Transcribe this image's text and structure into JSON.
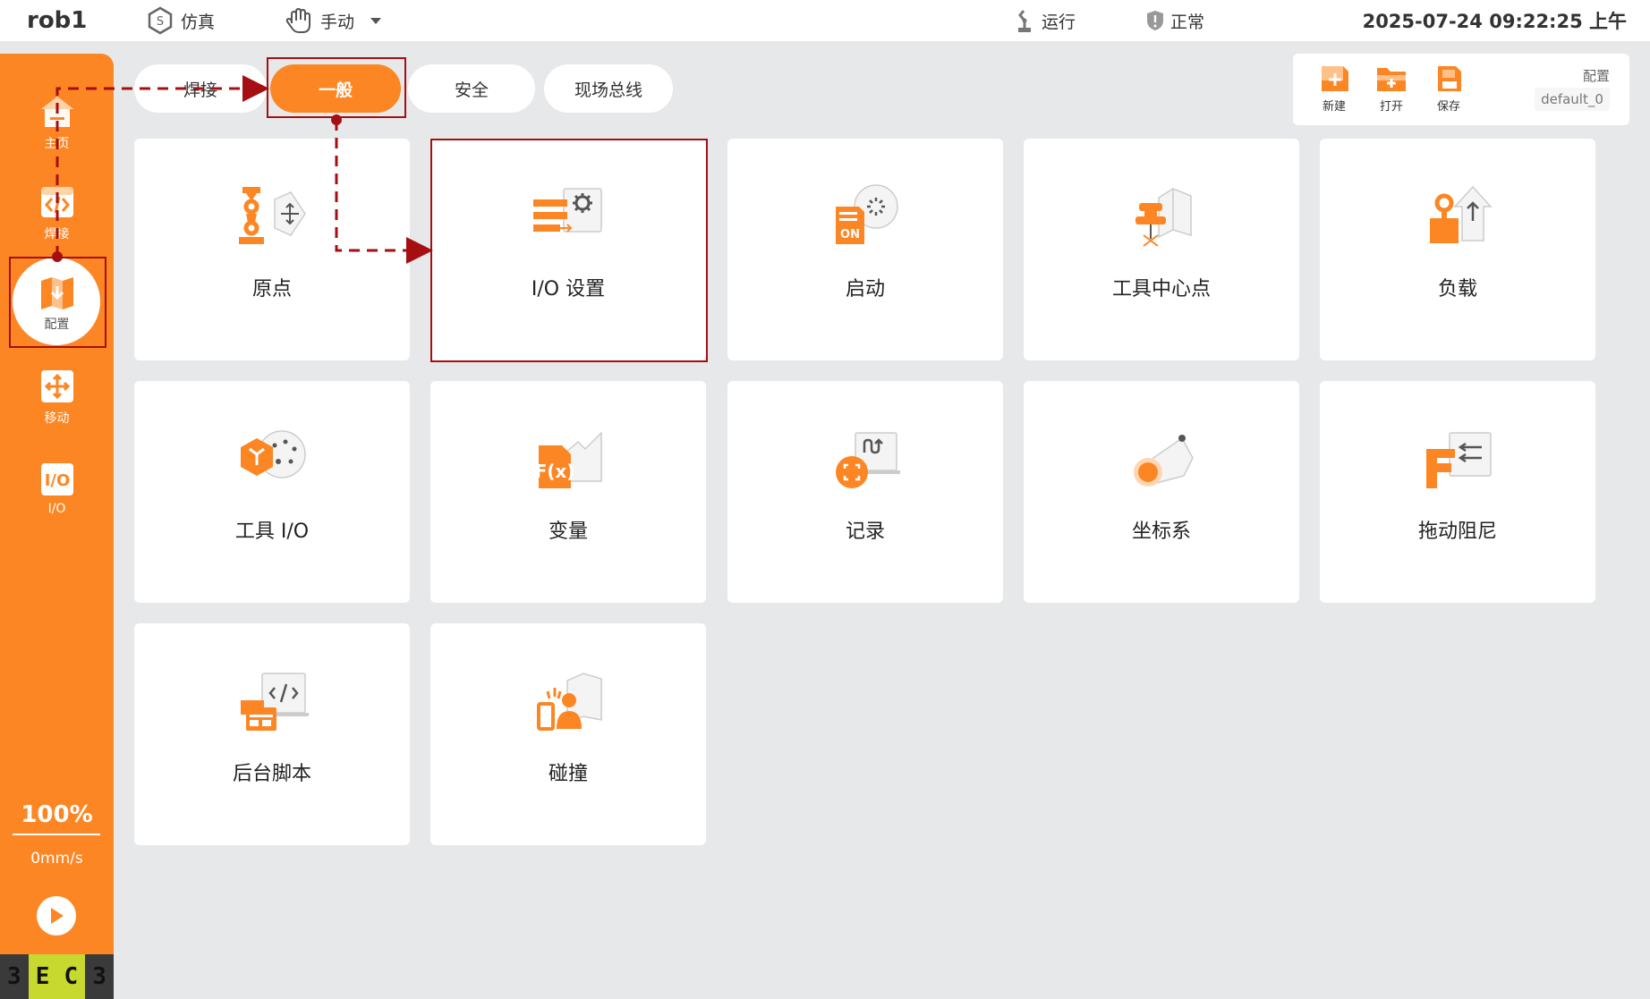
{
  "topbar": {
    "robot_name": "rob1",
    "simulation": "仿真",
    "mode": "手动",
    "run_status": "运行",
    "health_status": "正常",
    "datetime": "2025-07-24 09:22:25 上午"
  },
  "sidebar": {
    "items": [
      {
        "label": "主页"
      },
      {
        "label": "焊接"
      },
      {
        "label": "配置"
      },
      {
        "label": "移动"
      },
      {
        "label": "I/O"
      }
    ],
    "speed_percent": "100%",
    "speed_value": "0mm/s",
    "logo_chars": [
      "3",
      "E",
      "C",
      "3"
    ]
  },
  "tabs": [
    {
      "label": "焊接"
    },
    {
      "label": "一般"
    },
    {
      "label": "安全"
    },
    {
      "label": "现场总线"
    }
  ],
  "config_panel": {
    "new_label": "新建",
    "open_label": "打开",
    "save_label": "保存",
    "config_label": "配置",
    "config_value": "default_0"
  },
  "cards": [
    {
      "label": "原点"
    },
    {
      "label": "I/O 设置"
    },
    {
      "label": "启动"
    },
    {
      "label": "工具中心点"
    },
    {
      "label": "负载"
    },
    {
      "label": "工具 I/O"
    },
    {
      "label": "变量"
    },
    {
      "label": "记录"
    },
    {
      "label": "坐标系"
    },
    {
      "label": "拖动阻尼"
    },
    {
      "label": "后台脚本"
    },
    {
      "label": "碰撞"
    }
  ],
  "colors": {
    "accent": "#fd8624",
    "annotation": "#a60f12",
    "background": "#e7e8ea"
  }
}
